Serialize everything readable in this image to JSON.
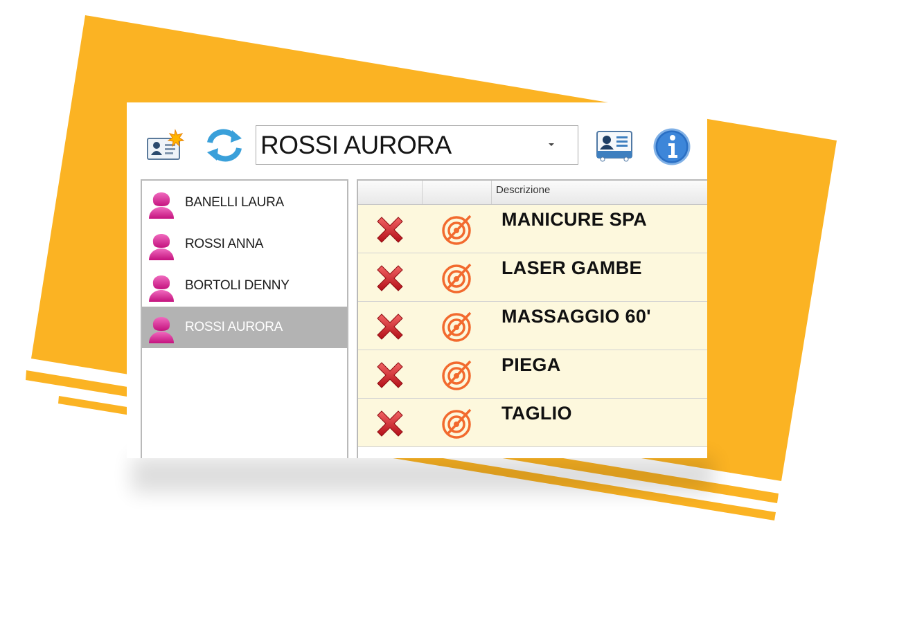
{
  "toolbar": {
    "new_client_icon": "new-client-card-icon",
    "refresh_icon": "refresh-icon",
    "selected_client": "ROSSI AURORA",
    "card_icon": "client-card-icon",
    "info_icon": "info-icon"
  },
  "clients": [
    {
      "name": "BANELLI LAURA",
      "selected": false
    },
    {
      "name": "ROSSI ANNA",
      "selected": false
    },
    {
      "name": "BORTOLI DENNY",
      "selected": false
    },
    {
      "name": "ROSSI AURORA",
      "selected": true
    }
  ],
  "grid": {
    "columns": [
      "",
      "",
      "Descrizione"
    ],
    "rows": [
      {
        "descrizione": "MANICURE SPA"
      },
      {
        "descrizione": "LASER GAMBE"
      },
      {
        "descrizione": "MASSAGGIO 60'"
      },
      {
        "descrizione": "PIEGA"
      },
      {
        "descrizione": "TAGLIO"
      }
    ]
  },
  "colors": {
    "accent_yellow": "#fbb323",
    "selected_row": "#b3b3b3",
    "grid_row_bg": "#fdf8dd",
    "avatar_pink": "#d81b8e",
    "delete_red": "#d8202a",
    "target_orange": "#f26a2e"
  }
}
